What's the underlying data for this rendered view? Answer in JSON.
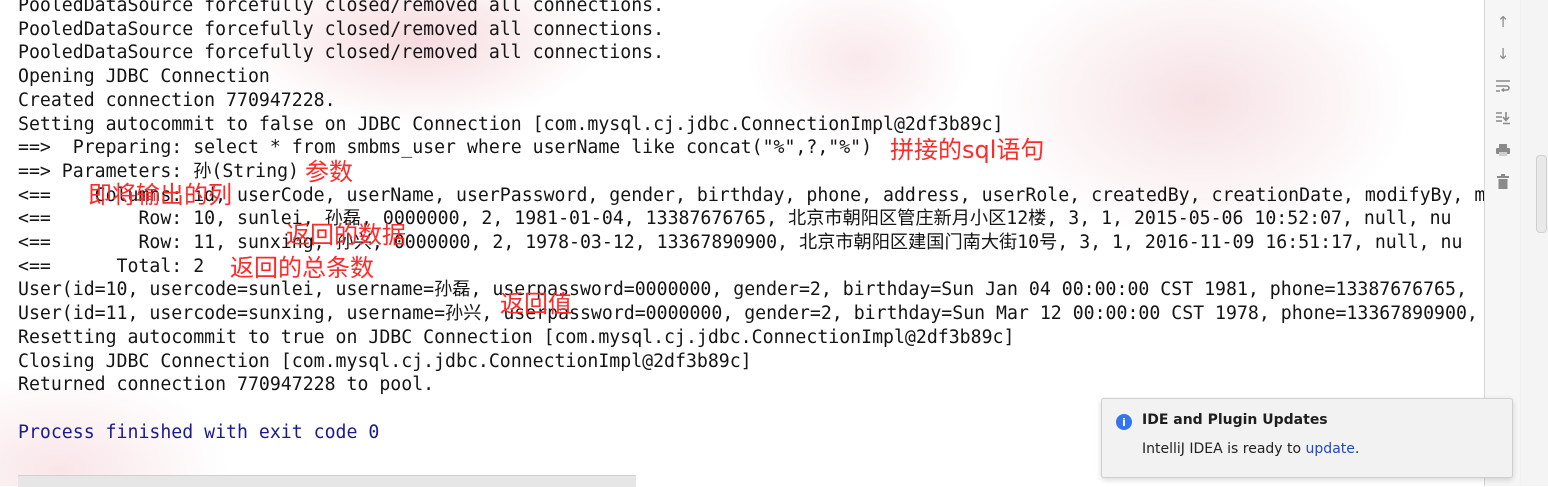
{
  "console": {
    "lines": [
      {
        "text": "PooledDataSource forcefully closed/removed all connections."
      },
      {
        "text": "PooledDataSource forcefully closed/removed all connections."
      },
      {
        "text": "PooledDataSource forcefully closed/removed all connections."
      },
      {
        "text": "Opening JDBC Connection"
      },
      {
        "text": "Created connection 770947228."
      },
      {
        "text": "Setting autocommit to false on JDBC Connection [com.mysql.cj.jdbc.ConnectionImpl@2df3b89c]"
      },
      {
        "text": "==>  Preparing: select * from smbms_user where userName like concat(\"%\",?,\"%\")"
      },
      {
        "text": "==> Parameters: 孙(String)"
      },
      {
        "text": "<==    Columns: id, userCode, userName, userPassword, gender, birthday, phone, address, userRole, createdBy, creationDate, modifyBy, m"
      },
      {
        "text": "<==        Row: 10, sunlei, 孙磊, 0000000, 2, 1981-01-04, 13387676765, 北京市朝阳区管庄新月小区12楼, 3, 1, 2015-05-06 10:52:07, null, nu"
      },
      {
        "text": "<==        Row: 11, sunxing, 孙兴, 0000000, 2, 1978-03-12, 13367890900, 北京市朝阳区建国门南大街10号, 3, 1, 2016-11-09 16:51:17, null, nu"
      },
      {
        "text": "<==      Total: 2"
      },
      {
        "text": "User(id=10, usercode=sunlei, username=孙磊, userpassword=0000000, gender=2, birthday=Sun Jan 04 00:00:00 CST 1981, phone=13387676765,"
      },
      {
        "text": "User(id=11, usercode=sunxing, username=孙兴, userpassword=0000000, gender=2, birthday=Sun Mar 12 00:00:00 CST 1978, phone=13367890900,"
      },
      {
        "text": "Resetting autocommit to true on JDBC Connection [com.mysql.cj.jdbc.ConnectionImpl@2df3b89c]"
      },
      {
        "text": "Closing JDBC Connection [com.mysql.cj.jdbc.ConnectionImpl@2df3b89c]"
      },
      {
        "text": "Returned connection 770947228 to pool."
      },
      {
        "text": ""
      },
      {
        "text": "Process finished with exit code 0"
      }
    ]
  },
  "annotations": {
    "sql_statement": "拼接的sql语句",
    "parameters": "参数",
    "output_columns": "即将输出的列",
    "returned_data": "返回的数据",
    "total_count": "返回的总条数",
    "return_value": "返回值"
  },
  "toolbar": {
    "icons": [
      "up-arrow-icon",
      "down-arrow-icon",
      "soft-wrap-icon",
      "scroll-to-end-icon",
      "print-icon",
      "trash-icon"
    ]
  },
  "notification": {
    "title": "IDE and Plugin Updates",
    "body_prefix": "IntelliJ IDEA is ready to ",
    "link_text": "update",
    "body_suffix": ".",
    "accent_color": "#3574f0"
  },
  "colors": {
    "annotation": "#ff2a2a",
    "console_text": "#141414",
    "finished_text": "#1a1a8c"
  }
}
